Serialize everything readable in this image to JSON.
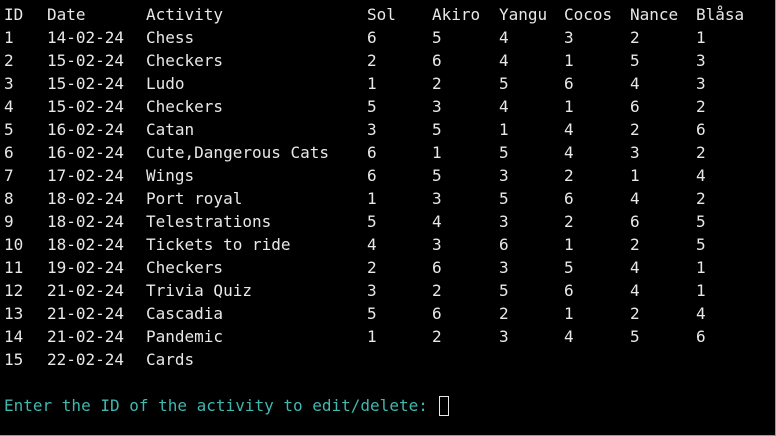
{
  "colors": {
    "background": "#000000",
    "text": "#e8e8e8",
    "prompt": "#3fb8b0"
  },
  "header": {
    "id": "ID",
    "date": "Date",
    "activity": "Activity",
    "players": [
      "Sol",
      "Akiro",
      "Yangu",
      "Cocos",
      "Nance",
      "Blåsa"
    ]
  },
  "rows": [
    {
      "id": "1",
      "date": "14-02-24",
      "activity": "Chess",
      "scores": [
        "6",
        "5",
        "4",
        "3",
        "2",
        "1"
      ]
    },
    {
      "id": "2",
      "date": "15-02-24",
      "activity": "Checkers",
      "scores": [
        "2",
        "6",
        "4",
        "1",
        "5",
        "3"
      ]
    },
    {
      "id": "3",
      "date": "15-02-24",
      "activity": "Ludo",
      "scores": [
        "1",
        "2",
        "5",
        "6",
        "4",
        "3"
      ]
    },
    {
      "id": "4",
      "date": "15-02-24",
      "activity": "Checkers",
      "scores": [
        "5",
        "3",
        "4",
        "1",
        "6",
        "2"
      ]
    },
    {
      "id": "5",
      "date": "16-02-24",
      "activity": "Catan",
      "scores": [
        "3",
        "5",
        "1",
        "4",
        "2",
        "6"
      ]
    },
    {
      "id": "6",
      "date": "16-02-24",
      "activity": "Cute,Dangerous Cats",
      "scores": [
        "6",
        "1",
        "5",
        "4",
        "3",
        "2"
      ]
    },
    {
      "id": "7",
      "date": "17-02-24",
      "activity": "Wings",
      "scores": [
        "6",
        "5",
        "3",
        "2",
        "1",
        "4"
      ]
    },
    {
      "id": "8",
      "date": "18-02-24",
      "activity": "Port royal",
      "scores": [
        "1",
        "3",
        "5",
        "6",
        "4",
        "2"
      ]
    },
    {
      "id": "9",
      "date": "18-02-24",
      "activity": "Telestrations",
      "scores": [
        "5",
        "4",
        "3",
        "2",
        "6",
        "5"
      ]
    },
    {
      "id": "10",
      "date": "18-02-24",
      "activity": "Tickets to ride",
      "scores": [
        "4",
        "3",
        "6",
        "1",
        "2",
        "5"
      ]
    },
    {
      "id": "11",
      "date": "19-02-24",
      "activity": "Checkers",
      "scores": [
        "2",
        "6",
        "3",
        "5",
        "4",
        "1"
      ]
    },
    {
      "id": "12",
      "date": "21-02-24",
      "activity": "Trivia Quiz",
      "scores": [
        "3",
        "2",
        "5",
        "6",
        "4",
        "1"
      ]
    },
    {
      "id": "13",
      "date": "21-02-24",
      "activity": "Cascadia",
      "scores": [
        "5",
        "6",
        "2",
        "1",
        "2",
        "4"
      ]
    },
    {
      "id": "14",
      "date": "21-02-24",
      "activity": "Pandemic",
      "scores": [
        "1",
        "2",
        "3",
        "4",
        "5",
        "6"
      ]
    },
    {
      "id": "15",
      "date": "22-02-24",
      "activity": "Cards",
      "scores": [
        "",
        "",
        "",
        "",
        "",
        ""
      ]
    }
  ],
  "prompt": {
    "text": "Enter the ID of the activity to edit/delete: ",
    "input_value": ""
  }
}
